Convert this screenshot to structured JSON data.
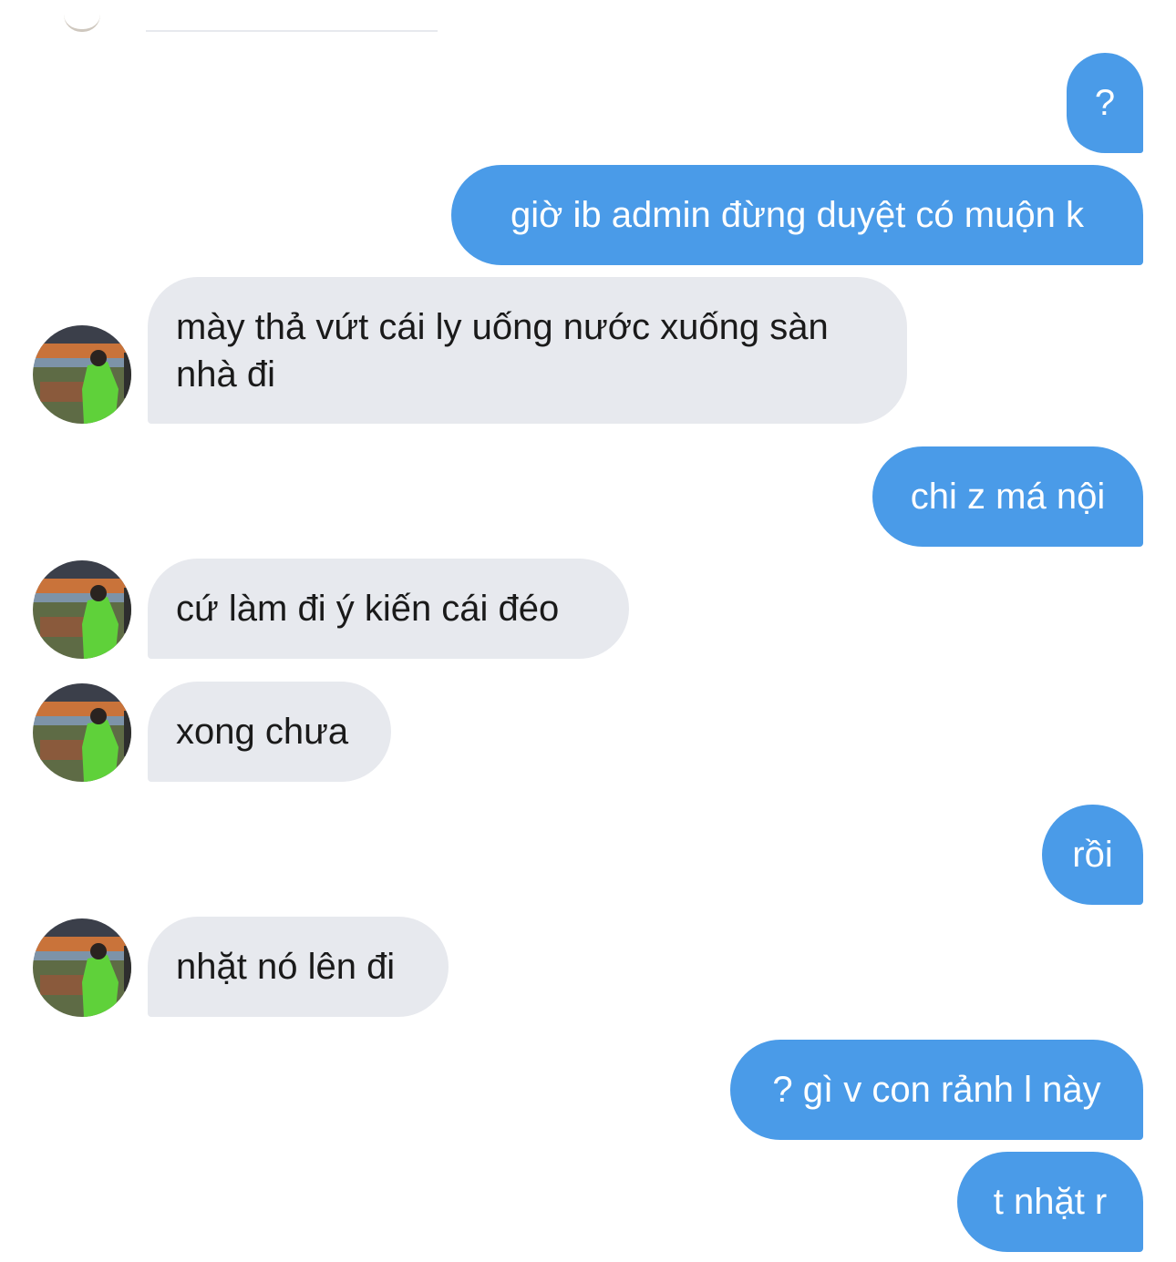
{
  "messages": [
    {
      "side": "out",
      "text": "?"
    },
    {
      "side": "out",
      "text": "giờ ib admin đừng duyệt có muộn k"
    },
    {
      "side": "in",
      "text": "mày thả vứt cái ly uống nước xuống sàn nhà đi"
    },
    {
      "side": "out",
      "text": "chi z má nội"
    },
    {
      "side": "in",
      "text": "cứ làm đi ý kiến cái đéo"
    },
    {
      "side": "in",
      "text": "xong chưa"
    },
    {
      "side": "out",
      "text": "rồi"
    },
    {
      "side": "in",
      "text": "nhặt nó lên đi"
    },
    {
      "side": "out",
      "text": "? gì v con rảnh l này"
    },
    {
      "side": "out",
      "text": "t nhặt r"
    }
  ],
  "colors": {
    "outgoing_bubble": "#4a9be8",
    "incoming_bubble": "#e7e9ee"
  }
}
